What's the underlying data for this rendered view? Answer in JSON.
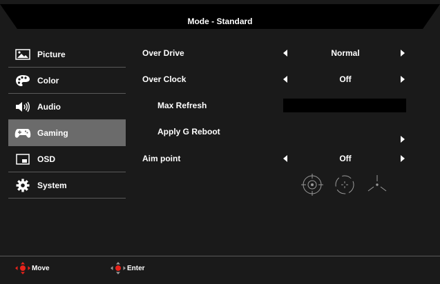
{
  "header": {
    "title": "Mode - Standard"
  },
  "sidebar": {
    "items": [
      {
        "label": "Picture",
        "icon": "picture-icon",
        "active": false
      },
      {
        "label": "Color",
        "icon": "palette-icon",
        "active": false
      },
      {
        "label": "Audio",
        "icon": "speaker-icon",
        "active": false
      },
      {
        "label": "Gaming",
        "icon": "gamepad-icon",
        "active": true
      },
      {
        "label": "OSD",
        "icon": "osd-window-icon",
        "active": false
      },
      {
        "label": "System",
        "icon": "gear-icon",
        "active": false
      }
    ]
  },
  "settings": {
    "over_drive": {
      "label": "Over Drive",
      "value": "Normal"
    },
    "over_clock": {
      "label": "Over Clock",
      "value": "Off"
    },
    "max_refresh": {
      "label": "Max Refresh"
    },
    "apply_g_reboot": {
      "label": "Apply G Reboot"
    },
    "aim_point": {
      "label": "Aim point",
      "value": "Off",
      "styles": [
        "crosshair-circle-icon",
        "crosshair-dotted-circle-icon",
        "crosshair-tri-line-icon"
      ]
    }
  },
  "footer": {
    "move_label": "Move",
    "enter_label": "Enter"
  },
  "colors": {
    "background": "#1a1a1a",
    "active": "#6b6b6b",
    "accent_red": "#e8231b",
    "text": "#ffffff"
  }
}
